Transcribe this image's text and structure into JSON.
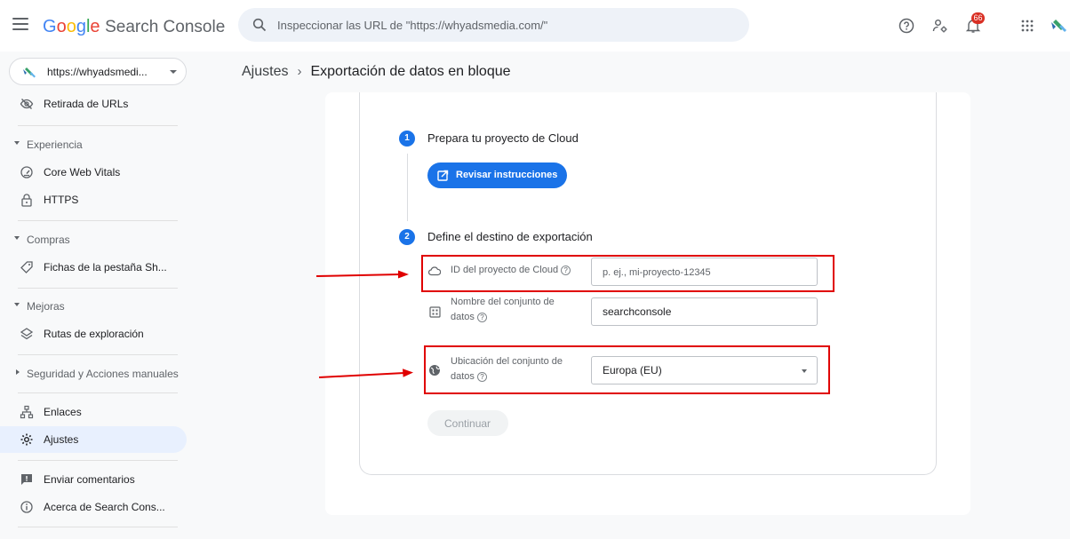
{
  "app": {
    "brand_parts": [
      "G",
      "o",
      "o",
      "g",
      "l",
      "e"
    ],
    "product": "Search Console",
    "notification_count": "66"
  },
  "search": {
    "placeholder": "Inspeccionar las URL de \"https://whyadsmedia.com/\""
  },
  "property": {
    "label": "https://whyadsmedi..."
  },
  "sidebar": {
    "removals": "Retirada de URLs",
    "section_experience": "Experiencia",
    "core_web_vitals": "Core Web Vitals",
    "https": "HTTPS",
    "section_shopping": "Compras",
    "shopping_tab": "Fichas de la pestaña Sh...",
    "section_enhancements": "Mejoras",
    "breadcrumbs": "Rutas de exploración",
    "section_security": "Seguridad y Acciones manuales",
    "links": "Enlaces",
    "settings": "Ajustes",
    "feedback": "Enviar comentarios",
    "about": "Acerca de Search Cons..."
  },
  "breadcrumb": {
    "parent": "Ajustes",
    "separator": "›",
    "current": "Exportación de datos en bloque"
  },
  "steps": {
    "step1_number": "1",
    "step1_title": "Prepara tu proyecto de Cloud",
    "review_button": "Revisar instrucciones",
    "step2_number": "2",
    "step2_title": "Define el destino de exportación"
  },
  "form": {
    "project_label": "ID del proyecto de Cloud",
    "project_placeholder": "p. ej., mi-proyecto-12345",
    "dataset_label_line1": "Nombre del conjunto de",
    "dataset_label_line2": "datos",
    "dataset_value": "searchconsole",
    "location_label_line1": "Ubicación del conjunto de",
    "location_label_line2": "datos",
    "location_value": "Europa (EU)",
    "help_glyph": "?",
    "continue_button": "Continuar"
  },
  "colors": {
    "accent": "#1a73e8",
    "annotation": "#e00000"
  }
}
